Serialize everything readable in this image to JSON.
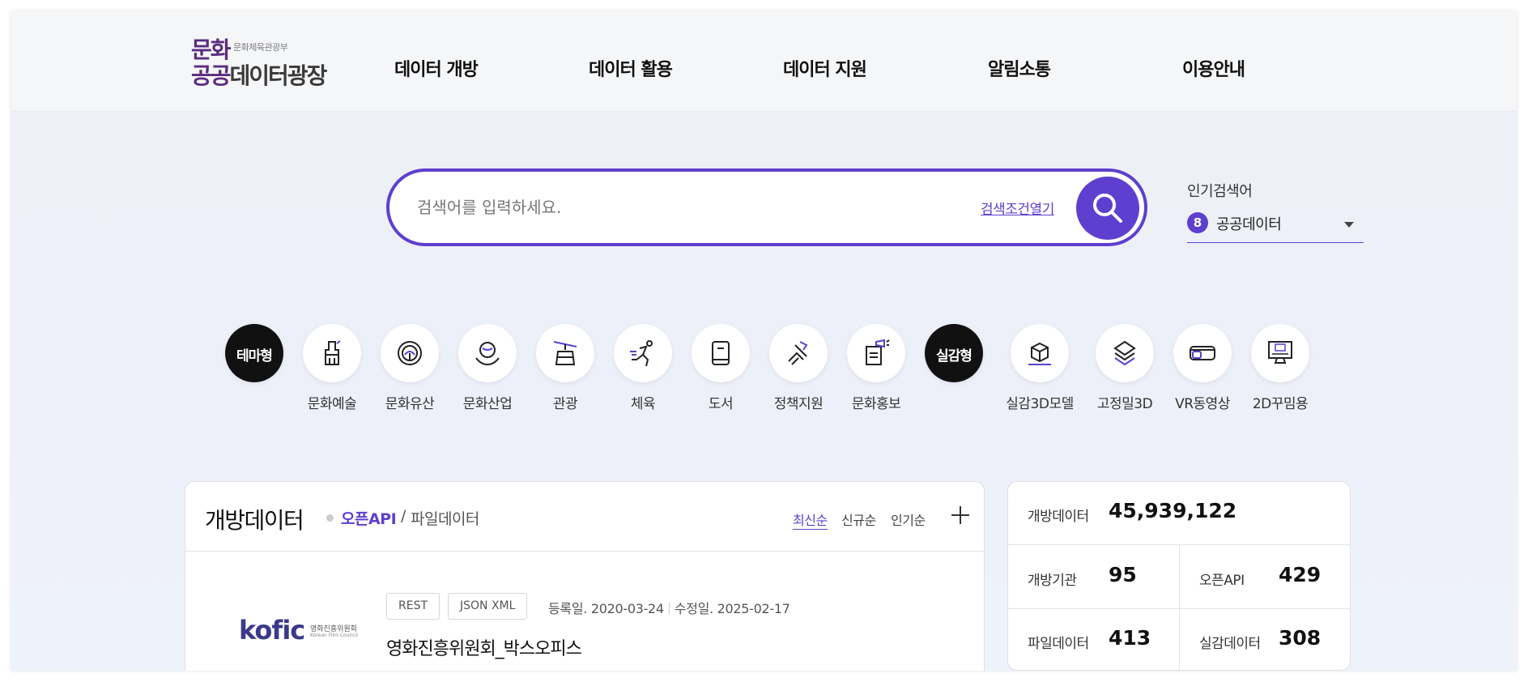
{
  "logo": {
    "line1": "문화",
    "small": "문화체육관광부",
    "line2_a": "공공",
    "line2_b": "데이터광장"
  },
  "gnb": [
    "데이터 개방",
    "데이터 활용",
    "데이터 지원",
    "알림소통",
    "이용안내"
  ],
  "search": {
    "placeholder": "검색어를 입력하세요.",
    "condition_link": "검색조건열기",
    "button_icon": "search-icon"
  },
  "popular": {
    "title": "인기검색어",
    "rank": "8",
    "keyword": "공공데이터"
  },
  "categories": {
    "theme_label": "테마형",
    "theme_items": [
      {
        "label": "문화예술",
        "icon": "paintbrush-icon"
      },
      {
        "label": "문화유산",
        "icon": "heritage-icon"
      },
      {
        "label": "문화산업",
        "icon": "globe-hands-icon"
      },
      {
        "label": "관광",
        "icon": "cablecar-icon"
      },
      {
        "label": "체육",
        "icon": "runner-icon"
      },
      {
        "label": "도서",
        "icon": "book-icon"
      },
      {
        "label": "정책지원",
        "icon": "handshake-icon"
      },
      {
        "label": "문화홍보",
        "icon": "megaphone-icon"
      }
    ],
    "real_label": "실감형",
    "real_items": [
      {
        "label": "실감3D모델",
        "icon": "cube-3d-icon"
      },
      {
        "label": "고정밀3D",
        "icon": "layers-icon"
      },
      {
        "label": "VR동영상",
        "icon": "vr-headset-icon"
      },
      {
        "label": "2D꾸밈용",
        "icon": "monitor-2d-icon"
      }
    ]
  },
  "open_data": {
    "title": "개방데이터",
    "tab_api": "오픈API",
    "tab_sep": "/",
    "tab_file": "파일데이터",
    "sorts": [
      "최신순",
      "신규순",
      "인기순"
    ],
    "item": {
      "logo_text": "kofic",
      "logo_sub": "영화진흥위원회",
      "logo_sub_en": "Korean Film Council",
      "badge1": "REST",
      "badge2": "JSON XML",
      "registered": "등록일. 2020-03-24",
      "modified": "수정일. 2025-02-17",
      "title": "영화진흥위원회_박스오피스"
    }
  },
  "stats": {
    "total_label": "개방데이터",
    "total_value": "45,939,122",
    "org_label": "개방기관",
    "org_value": "95",
    "api_label": "오픈API",
    "api_value": "429",
    "file_label": "파일데이터",
    "file_value": "413",
    "real_label": "실감데이터",
    "real_value": "308"
  },
  "colors": {
    "accent": "#5e3fcf",
    "logo": "#5b2c7f",
    "background": "#eef0f8"
  }
}
